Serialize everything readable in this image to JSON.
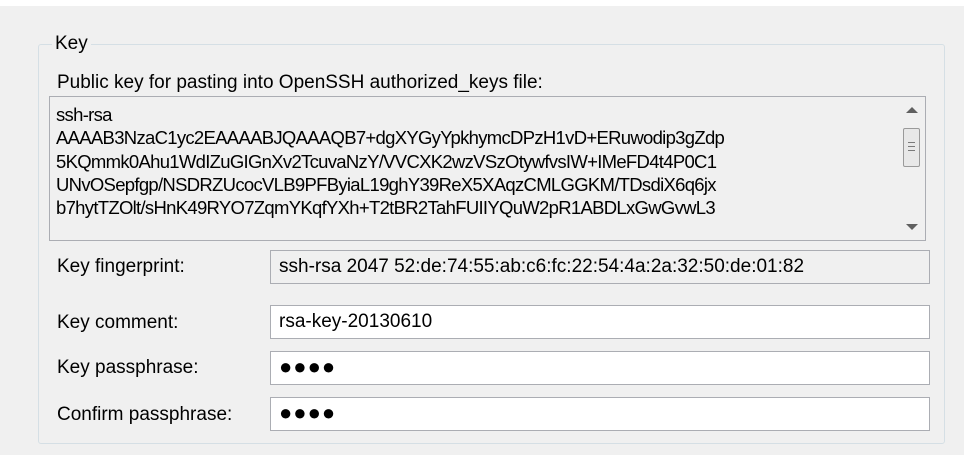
{
  "group": {
    "title": "Key"
  },
  "public_key": {
    "caption": "Public key for pasting into OpenSSH authorized_keys file:",
    "lines": [
      "ssh-rsa",
      "AAAAB3NzaC1yc2EAAAABJQAAAQB7+dgXYGyYpkhymcDPzH1vD+ERuwodip3gZdp",
      "5KQmmk0Ahu1WdIZuGIGnXv2TcuvaNzY/VVCXK2wzVSzOtywfvsIW+IMeFD4t4P0C1",
      "UNvOSepfgp/NSDRZUcocVLB9PFByiaL19ghY39ReX5XAqzCMLGGKM/TDsdiX6q6jx",
      "b7hytTZOlt/sHnK49RYO7ZqmYKqfYXh+T2tBR2TahFUIIYQuW2pR1ABDLxGwGvwL3"
    ]
  },
  "fields": {
    "fingerprint": {
      "label": "Key fingerprint:",
      "value": "ssh-rsa 2047 52:de:74:55:ab:c6:fc:22:54:4a:2a:32:50:de:01:82"
    },
    "comment": {
      "label": "Key comment:",
      "value": "rsa-key-20130610"
    },
    "passphrase": {
      "label": "Key passphrase:",
      "value": "●●●●"
    },
    "confirm": {
      "label": "Confirm passphrase:",
      "value": "●●●●"
    }
  }
}
